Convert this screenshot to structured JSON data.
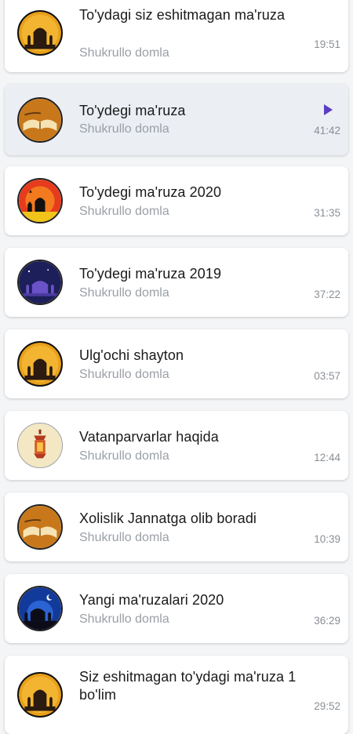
{
  "items": [
    {
      "title": "To'ydagi siz eshitmagan ma'ruza",
      "author": "Shukrullo domla",
      "duration": "19:51",
      "icon": "mosque-night-icon",
      "active": false
    },
    {
      "title": "To'ydegi ma'ruza",
      "author": "Shukrullo domla",
      "duration": "41:42",
      "icon": "quran-book-icon",
      "active": true
    },
    {
      "title": "To'ydegi ma'ruza 2020",
      "author": "Shukrullo domla",
      "duration": "31:35",
      "icon": "mosque-sunset-icon",
      "active": false
    },
    {
      "title": "To'ydegi ma'ruza 2019",
      "author": "Shukrullo domla",
      "duration": "37:22",
      "icon": "mosque-purple-night-icon",
      "active": false
    },
    {
      "title": "Ulg'ochi shayton",
      "author": "Shukrullo domla",
      "duration": "03:57",
      "icon": "mosque-night-icon",
      "active": false
    },
    {
      "title": "Vatanparvarlar haqida",
      "author": "Shukrullo domla",
      "duration": "12:44",
      "icon": "lantern-icon",
      "active": false
    },
    {
      "title": "Xolislik Jannatga olib boradi",
      "author": "Shukrullo domla",
      "duration": "10:39",
      "icon": "quran-book-icon",
      "active": false
    },
    {
      "title": "Yangi ma'ruzalari 2020",
      "author": "Shukrullo domla",
      "duration": "36:29",
      "icon": "mosque-blue-night-icon",
      "active": false
    },
    {
      "title": "Siz eshitmagan to'ydagi ma'ruza 1 bo'lim",
      "author": "Shukrullo domla",
      "duration": "29:52",
      "icon": "mosque-night-icon",
      "active": false
    }
  ],
  "colors": {
    "accent": "#5b3cc4",
    "background": "#f4f5f7",
    "active_card": "#ebeef3"
  }
}
